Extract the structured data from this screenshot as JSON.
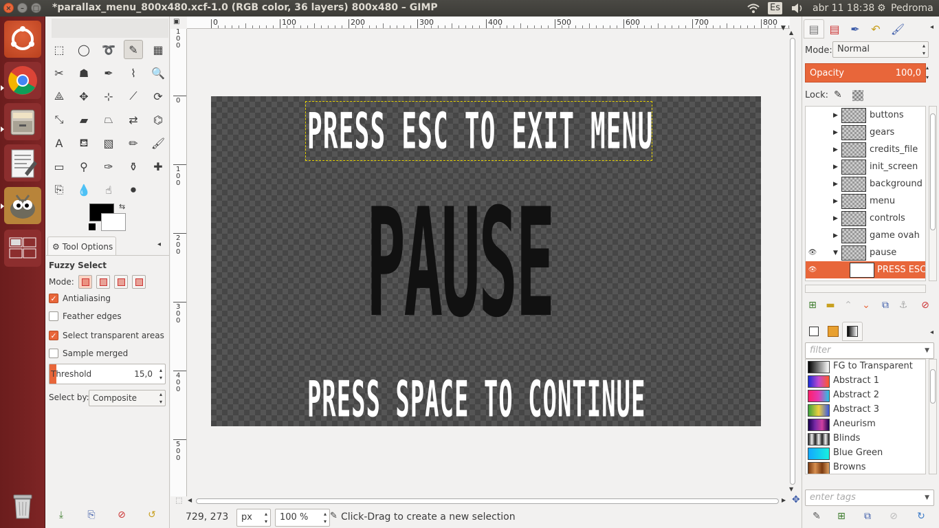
{
  "window": {
    "title": "*parallax_menu_800x480.xcf-1.0 (RGB color, 36 layers) 800x480 – GIMP",
    "close_glyph": "×",
    "min_glyph": "–",
    "max_glyph": "□"
  },
  "tray": {
    "keyboard": "Es",
    "datetime": "abr 11 18:38",
    "user": "Pedroma"
  },
  "launcher": [
    "ubuntu-icon",
    "chrome-icon",
    "files-icon",
    "text-editor-icon",
    "gimp-icon",
    "workspace-switcher-icon",
    "trash-icon"
  ],
  "tools": [
    {
      "icon": "rect-select-icon",
      "glyph": "⬚"
    },
    {
      "icon": "ellipse-select-icon",
      "glyph": "◯"
    },
    {
      "icon": "free-select-icon",
      "glyph": "➰"
    },
    {
      "icon": "fuzzy-select-icon",
      "glyph": "✎"
    },
    {
      "icon": "select-by-color-icon",
      "glyph": "▦"
    },
    {
      "icon": "scissors-icon",
      "glyph": "✂"
    },
    {
      "icon": "foreground-select-icon",
      "glyph": "☗"
    },
    {
      "icon": "paths-icon",
      "glyph": "✒"
    },
    {
      "icon": "color-picker-icon",
      "glyph": "⌇"
    },
    {
      "icon": "zoom-icon",
      "glyph": "🔍"
    },
    {
      "icon": "measure-icon",
      "glyph": "⟁"
    },
    {
      "icon": "move-icon",
      "glyph": "✥"
    },
    {
      "icon": "align-icon",
      "glyph": "⊹"
    },
    {
      "icon": "crop-icon",
      "glyph": "⟋"
    },
    {
      "icon": "rotate-icon",
      "glyph": "⟳"
    },
    {
      "icon": "scale-icon",
      "glyph": "⤡"
    },
    {
      "icon": "shear-icon",
      "glyph": "▰"
    },
    {
      "icon": "perspective-icon",
      "glyph": "⏢"
    },
    {
      "icon": "flip-icon",
      "glyph": "⇄"
    },
    {
      "icon": "cage-icon",
      "glyph": "⌬"
    },
    {
      "icon": "text-icon",
      "glyph": "A"
    },
    {
      "icon": "bucket-fill-icon",
      "glyph": "⛾"
    },
    {
      "icon": "blend-icon",
      "glyph": "▧"
    },
    {
      "icon": "pencil-icon",
      "glyph": "✏"
    },
    {
      "icon": "paintbrush-icon",
      "glyph": "🖌"
    },
    {
      "icon": "eraser-icon",
      "glyph": "▭"
    },
    {
      "icon": "airbrush-icon",
      "glyph": "⚲"
    },
    {
      "icon": "ink-icon",
      "glyph": "✑"
    },
    {
      "icon": "clone-icon",
      "glyph": "⚱"
    },
    {
      "icon": "heal-icon",
      "glyph": "✚"
    },
    {
      "icon": "perspective-clone-icon",
      "glyph": "⎘"
    },
    {
      "icon": "blur-icon",
      "glyph": "💧"
    },
    {
      "icon": "smudge-icon",
      "glyph": "☝"
    },
    {
      "icon": "dodge-burn-icon",
      "glyph": "⚫"
    }
  ],
  "tool_options": {
    "tab_label": "Tool Options",
    "tool_name": "Fuzzy Select",
    "mode_label": "Mode:",
    "antialiasing": "Antialiasing",
    "feather_edges": "Feather edges",
    "select_transparent": "Select transparent areas",
    "sample_merged": "Sample merged",
    "threshold_label": "Threshold",
    "threshold_value": "15,0",
    "threshold_fraction": 0.06,
    "select_by_label": "Select by:",
    "select_by_value": "Composite",
    "checks": {
      "antialiasing": "✓",
      "feather": "",
      "transparent": "✓",
      "merged": ""
    }
  },
  "canvas": {
    "ruler_h": [
      "0",
      "100",
      "200",
      "300",
      "400",
      "500",
      "600",
      "700",
      "800"
    ],
    "ruler_v": [
      "1\n0\n0",
      "0",
      "1\n0\n0",
      "2\n0\n0",
      "3\n0\n0",
      "4\n0\n0",
      "5\n0\n0"
    ],
    "text_top": "PRESS ESC TO EXIT MENU",
    "text_pause": "PAUSE",
    "text_bottom": "PRESS SPACE TO CONTINUE"
  },
  "status": {
    "coords": "729, 273",
    "unit": "px",
    "zoom": "100 %",
    "message": "Click-Drag to create a new selection"
  },
  "layers": {
    "mode_label": "Mode:",
    "mode_value": "Normal",
    "opacity_label": "Opacity",
    "opacity_value": "100,0",
    "lock_label": "Lock:",
    "items": [
      {
        "name": "buttons",
        "visible": false,
        "expander": "▶"
      },
      {
        "name": "gears",
        "visible": false,
        "expander": "▶"
      },
      {
        "name": "credits_file",
        "visible": false,
        "expander": "▶"
      },
      {
        "name": "init_screen",
        "visible": false,
        "expander": "▶"
      },
      {
        "name": "background",
        "visible": false,
        "expander": "▶"
      },
      {
        "name": "menu",
        "visible": false,
        "expander": "▶"
      },
      {
        "name": "controls",
        "visible": false,
        "expander": "▶"
      },
      {
        "name": "game ovah",
        "visible": false,
        "expander": "▶"
      },
      {
        "name": "pause",
        "visible": true,
        "expander": "▼"
      },
      {
        "name": "PRESS ESC T",
        "visible": true,
        "expander": ""
      }
    ]
  },
  "gradients": {
    "filter_placeholder": "filter",
    "tags_placeholder": "enter tags",
    "items": [
      {
        "name": "FG to Transparent",
        "colors": "linear-gradient(90deg,#000,rgba(0,0,0,0))"
      },
      {
        "name": "Abstract 1",
        "colors": "linear-gradient(90deg,#1a2bd6,#c44ad0,#ff5a2a)"
      },
      {
        "name": "Abstract 2",
        "colors": "linear-gradient(90deg,#ff1f6b,#e23bb3,#27c4e6)"
      },
      {
        "name": "Abstract 3",
        "colors": "linear-gradient(90deg,#3ba33b,#f0d040,#3c5ae0)"
      },
      {
        "name": "Aneurism",
        "colors": "linear-gradient(90deg,#1a0050,#7a2aa8,#d040a0,#1a0050)"
      },
      {
        "name": "Blinds",
        "colors": "repeating-linear-gradient(90deg,#222 0,#eee 5px,#222 10px)"
      },
      {
        "name": "Blue Green",
        "colors": "linear-gradient(90deg,#12a8ff,#18f0e0)"
      },
      {
        "name": "Browns",
        "colors": "linear-gradient(90deg,#7a3a10,#d89050,#7a3a10,#e0a060)"
      }
    ]
  },
  "colors": {
    "accent": "#e8663a",
    "launcher": "#7e2525"
  }
}
